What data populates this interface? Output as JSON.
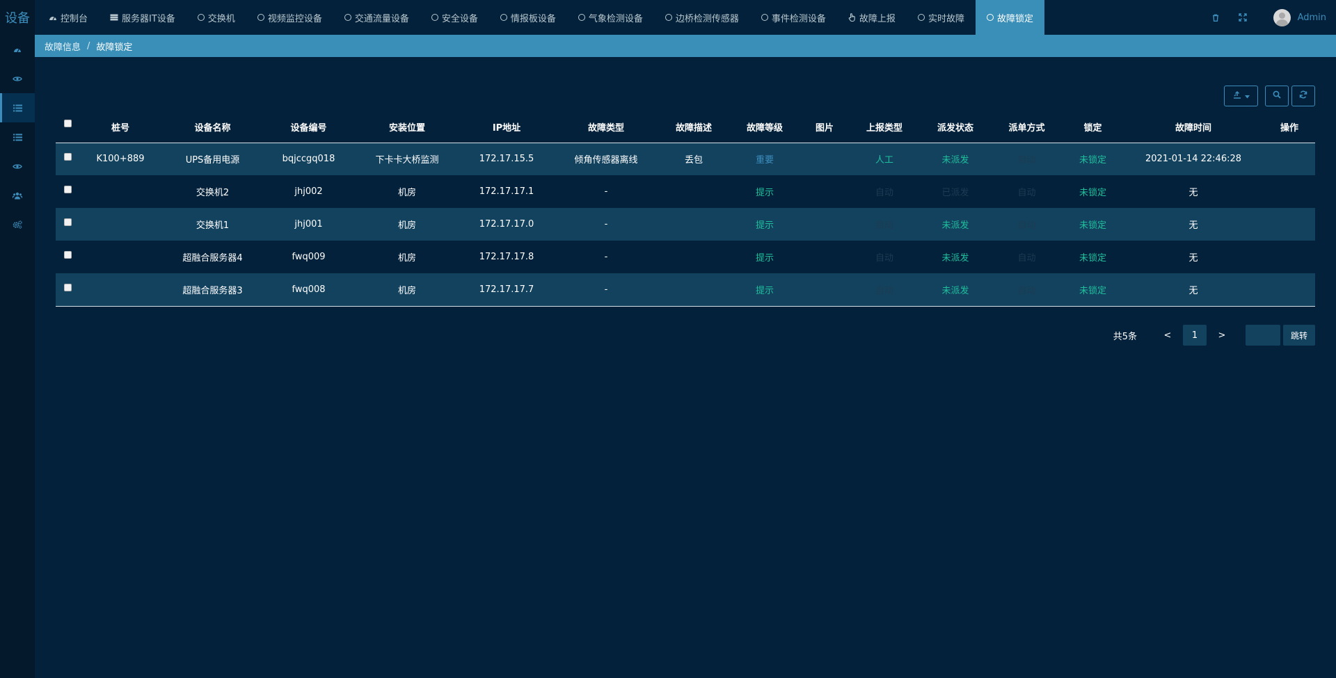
{
  "brand": "设备",
  "tabs": [
    {
      "label": "控制台",
      "icon": "dashboard-icon"
    },
    {
      "label": "服务器IT设备",
      "icon": "server-icon"
    },
    {
      "label": "交换机",
      "icon": "circle-icon"
    },
    {
      "label": "视频监控设备",
      "icon": "circle-icon"
    },
    {
      "label": "交通流量设备",
      "icon": "circle-icon"
    },
    {
      "label": "安全设备",
      "icon": "circle-icon"
    },
    {
      "label": "情报板设备",
      "icon": "circle-icon"
    },
    {
      "label": "气象检测设备",
      "icon": "circle-icon"
    },
    {
      "label": "边桥检测传感器",
      "icon": "circle-icon"
    },
    {
      "label": "事件检测设备",
      "icon": "circle-icon"
    },
    {
      "label": "故障上报",
      "icon": "hand-pointer-icon"
    },
    {
      "label": "实时故障",
      "icon": "circle-icon"
    },
    {
      "label": "故障锁定",
      "icon": "circle-icon",
      "active": true
    }
  ],
  "user": {
    "name": "Admin"
  },
  "sidebar": [
    {
      "icon": "dashboard-icon"
    },
    {
      "icon": "eye-icon"
    },
    {
      "icon": "list-icon",
      "active": true
    },
    {
      "icon": "list-icon"
    },
    {
      "icon": "eye-icon"
    },
    {
      "icon": "users-icon"
    },
    {
      "icon": "cogs-icon"
    }
  ],
  "breadcrumb": {
    "parent": "故障信息",
    "separator": "/",
    "current": "故障锁定"
  },
  "table": {
    "columns": [
      "桩号",
      "设备名称",
      "设备编号",
      "安装位置",
      "IP地址",
      "故障类型",
      "故障描述",
      "故障等级",
      "图片",
      "上报类型",
      "派发状态",
      "派单方式",
      "锁定",
      "故障时间",
      "操作"
    ],
    "rows": [
      {
        "stake": "K100+889",
        "name": "UPS备用电源",
        "code": "bqjccgq018",
        "location": "下卡卡大桥监测",
        "ip": "172.17.15.5",
        "fault_type": "倾角传感器离线",
        "desc": "丢包",
        "level": "重要",
        "image": "",
        "report_type": "人工",
        "dispatch_status": "未派发",
        "dispatch_mode": "自动",
        "lock": "未锁定",
        "time": "2021-01-14 22:46:28",
        "action": ""
      },
      {
        "stake": "",
        "name": "交换机2",
        "code": "jhj002",
        "location": "机房",
        "ip": "172.17.17.1",
        "fault_type": "-",
        "desc": "",
        "level": "提示",
        "image": "",
        "report_type": "自动",
        "dispatch_status": "已派发",
        "dispatch_mode": "自动",
        "lock": "未锁定",
        "time": "无",
        "action": ""
      },
      {
        "stake": "",
        "name": "交换机1",
        "code": "jhj001",
        "location": "机房",
        "ip": "172.17.17.0",
        "fault_type": "-",
        "desc": "",
        "level": "提示",
        "image": "",
        "report_type": "自动",
        "dispatch_status": "未派发",
        "dispatch_mode": "自动",
        "lock": "未锁定",
        "time": "无",
        "action": ""
      },
      {
        "stake": "",
        "name": "超融合服务器4",
        "code": "fwq009",
        "location": "机房",
        "ip": "172.17.17.8",
        "fault_type": "-",
        "desc": "",
        "level": "提示",
        "image": "",
        "report_type": "自动",
        "dispatch_status": "未派发",
        "dispatch_mode": "自动",
        "lock": "未锁定",
        "time": "无",
        "action": ""
      },
      {
        "stake": "",
        "name": "超融合服务器3",
        "code": "fwq008",
        "location": "机房",
        "ip": "172.17.17.7",
        "fault_type": "-",
        "desc": "",
        "level": "提示",
        "image": "",
        "report_type": "自动",
        "dispatch_status": "未派发",
        "dispatch_mode": "自动",
        "lock": "未锁定",
        "time": "无",
        "action": ""
      }
    ]
  },
  "pagination": {
    "total_text": "共5条",
    "prev": "<",
    "page": "1",
    "next": ">",
    "jump_value": "",
    "jump_label": "跳转"
  },
  "colors": {
    "primary": "#3c8dbc",
    "level_important": "#3c8dbc",
    "teal": "#1fbf9c",
    "muted": "#1d3b52",
    "row_stripe": "#13425f",
    "background": "#03213a"
  }
}
